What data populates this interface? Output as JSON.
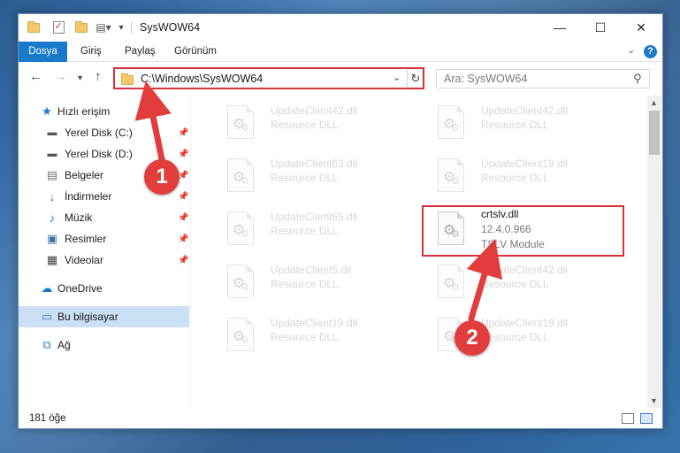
{
  "window": {
    "title": "SysWOW64",
    "controls": {
      "minimize": "—",
      "maximize": "☐",
      "close": "✕"
    }
  },
  "ribbon": {
    "tabs": [
      "Dosya",
      "Giriş",
      "Paylaş",
      "Görünüm"
    ],
    "help": "?"
  },
  "address": {
    "path": "C:\\Windows\\SysWOW64",
    "search_placeholder": "Ara: SysWOW64"
  },
  "navpane": {
    "quick_access": "Hızlı erişim",
    "items": [
      {
        "label": "Yerel Disk (C:)",
        "icon": "drive-icon",
        "pinned": true
      },
      {
        "label": "Yerel Disk (D:)",
        "icon": "drive-icon",
        "pinned": true
      },
      {
        "label": "Belgeler",
        "icon": "documents-icon",
        "pinned": true
      },
      {
        "label": "İndirmeler",
        "icon": "downloads-icon",
        "pinned": true
      },
      {
        "label": "Müzik",
        "icon": "music-icon",
        "pinned": true
      },
      {
        "label": "Resimler",
        "icon": "pictures-icon",
        "pinned": true
      },
      {
        "label": "Videolar",
        "icon": "videos-icon",
        "pinned": true
      }
    ],
    "onedrive": "OneDrive",
    "this_pc": "Bu bilgisayar",
    "network": "Ağ"
  },
  "files": [
    {
      "name": "UpdateClient42.dll",
      "desc": "Resource DLL",
      "faded": true
    },
    {
      "name": "UpdateClient42.dll",
      "desc": "Resource DLL",
      "faded": true
    },
    {
      "name": "UpdateClient63.dll",
      "desc": "Resource DLL",
      "faded": true
    },
    {
      "name": "UpdateClient19.dll",
      "desc": "Resource DLL",
      "faded": true
    },
    {
      "name": "UpdateClient65.dll",
      "desc": "Resource DLL",
      "faded": true
    },
    {
      "name": "crtslv.dll",
      "version": "12.4.0.966",
      "desc": "TSLV Module",
      "faded": false
    },
    {
      "name": "UpdateClient5.dll",
      "desc": "Resource DLL",
      "faded": true
    },
    {
      "name": "UpdateClient42.dll",
      "desc": "Resource DLL",
      "faded": true
    },
    {
      "name": "UpdateClient19.dll",
      "desc": "Resource DLL",
      "faded": true
    },
    {
      "name": "UpdateClient19.dll",
      "desc": "Resource DLL",
      "faded": true
    }
  ],
  "status": {
    "item_count": "181 öğe"
  },
  "annotations": {
    "step1": "1",
    "step2": "2",
    "color": "#e23d3d"
  }
}
